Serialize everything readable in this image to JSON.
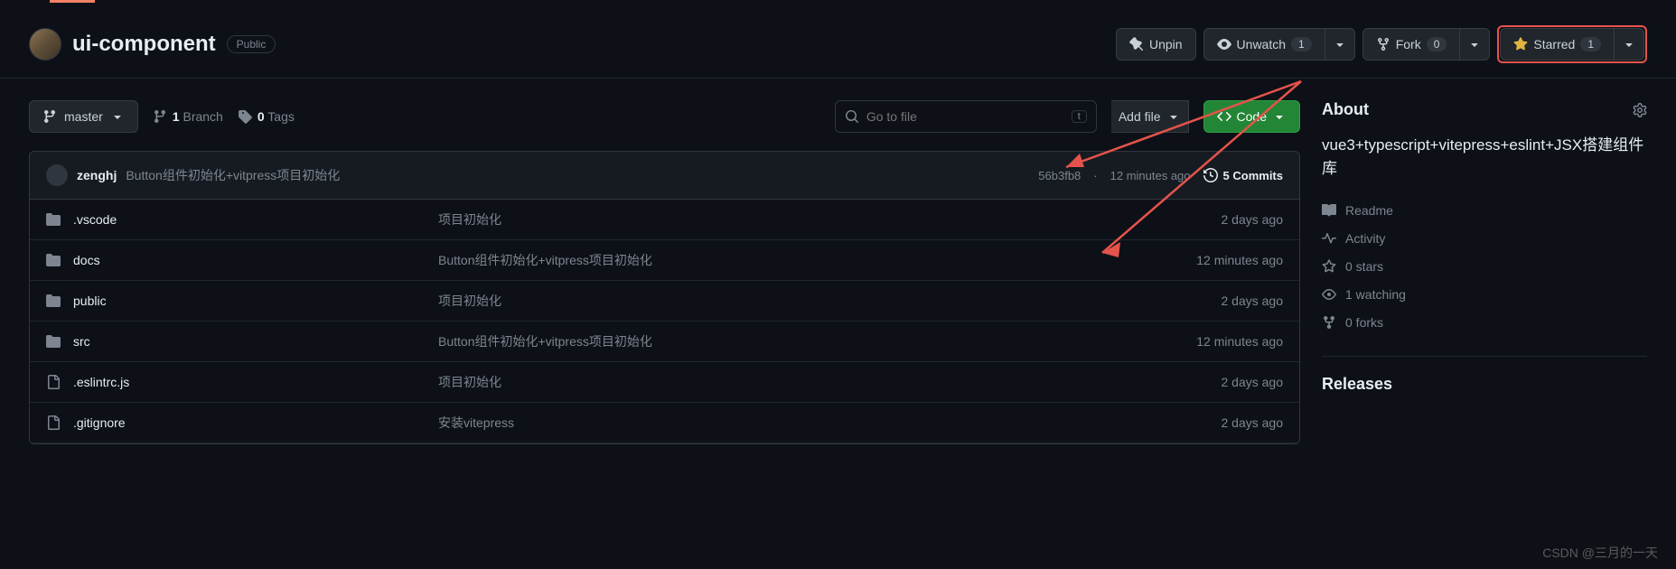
{
  "header": {
    "repo_name": "ui-component",
    "visibility": "Public",
    "unpin_label": "Unpin",
    "unwatch_label": "Unwatch",
    "unwatch_count": "1",
    "fork_label": "Fork",
    "fork_count": "0",
    "starred_label": "Starred",
    "starred_count": "1"
  },
  "toolbar": {
    "branch_name": "master",
    "branch_count": "1",
    "branch_label": "Branch",
    "tag_count": "0",
    "tag_label": "Tags",
    "search_placeholder": "Go to file",
    "search_key": "t",
    "add_file_label": "Add file",
    "code_label": "Code"
  },
  "commit": {
    "author": "zenghj",
    "message": "Button组件初始化+vitpress项目初始化",
    "sha": "56b3fb8",
    "time": "12 minutes ago",
    "commits_count": "5 Commits"
  },
  "files": [
    {
      "type": "folder",
      "name": ".vscode",
      "msg": "项目初始化",
      "time": "2 days ago"
    },
    {
      "type": "folder",
      "name": "docs",
      "msg": "Button组件初始化+vitpress项目初始化",
      "time": "12 minutes ago"
    },
    {
      "type": "folder",
      "name": "public",
      "msg": "项目初始化",
      "time": "2 days ago"
    },
    {
      "type": "folder",
      "name": "src",
      "msg": "Button组件初始化+vitpress项目初始化",
      "time": "12 minutes ago"
    },
    {
      "type": "file",
      "name": ".eslintrc.js",
      "msg": "项目初始化",
      "time": "2 days ago"
    },
    {
      "type": "file",
      "name": ".gitignore",
      "msg": "安装vitepress",
      "time": "2 days ago"
    }
  ],
  "about": {
    "heading": "About",
    "description": "vue3+typescript+vitepress+eslint+JSX搭建组件库",
    "readme": "Readme",
    "activity": "Activity",
    "stars": "0 stars",
    "watching": "1 watching",
    "forks": "0 forks",
    "releases_heading": "Releases"
  },
  "watermark": "CSDN @三月的一天"
}
